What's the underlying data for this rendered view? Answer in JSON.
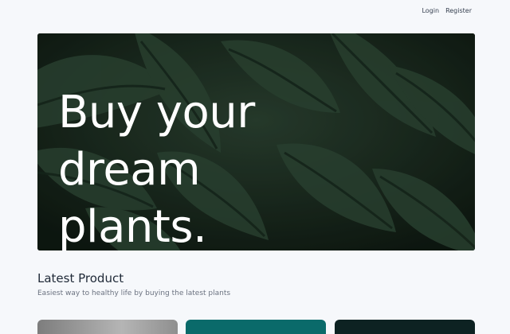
{
  "nav": {
    "login_label": "Login",
    "register_label": "Register"
  },
  "hero": {
    "title": "Buy your dream plants.",
    "background_color": "#162419"
  },
  "latest": {
    "title": "Latest Product",
    "subtitle": "Easiest way to healthy life by buying the latest plants"
  },
  "cards": [
    {
      "color": "#8a8a8a"
    },
    {
      "color": "#0a6a6a"
    },
    {
      "color": "#0d2222"
    }
  ]
}
